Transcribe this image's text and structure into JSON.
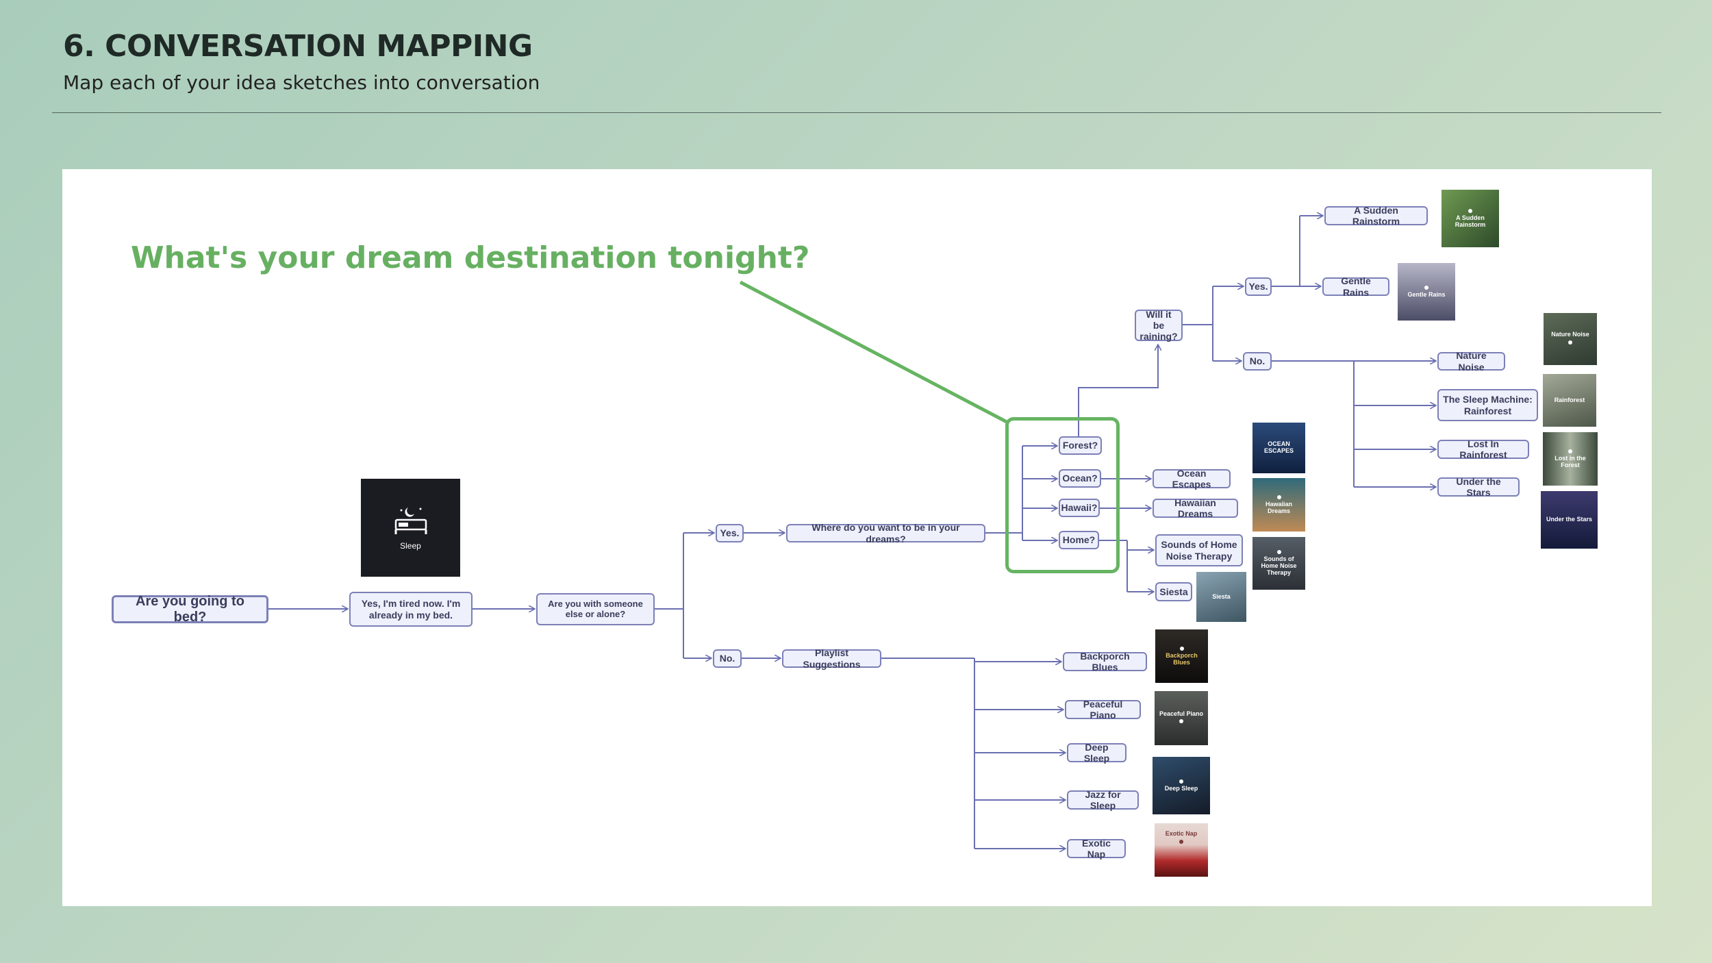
{
  "header": {
    "title": "6. CONVERSATION MAPPING",
    "subtitle": "Map each of your idea sketches into conversation"
  },
  "callout": {
    "text": "What's your dream destination tonight?",
    "color": "#67b062"
  },
  "colors": {
    "node_border": "#7c80b6",
    "node_fill": "#eef0fb",
    "edge": "#6a6fb0",
    "highlight": "#66b462"
  },
  "nodes": {
    "root": "Are you going to bed?",
    "tired": "Yes, I'm tired now. I'm already in my bed.",
    "alone": "Are you with someone else or alone?",
    "yes1": "Yes.",
    "no1": "No.",
    "where": "Where do you want to be in your dreams?",
    "playlist": "Playlist Suggestions",
    "forest": "Forest?",
    "ocean": "Ocean?",
    "hawaii": "Hawaii?",
    "home": "Home?",
    "raining": "Will it be raining?",
    "yes2": "Yes.",
    "no2": "No.",
    "sudden": "A Sudden Rainstorm",
    "gentle": "Gentle Rains",
    "nature": "Nature Noise",
    "sleepmachine": "The Sleep Machine: Rainforest",
    "lost": "Lost In Rainforest",
    "stars": "Under the Stars",
    "oceanesc": "Ocean Escapes",
    "hawaiian": "Hawaiian Dreams",
    "soundshome": "Sounds of Home Noise Therapy",
    "siesta": "Siesta",
    "backporch": "Backporch Blues",
    "piano": "Peaceful Piano",
    "deepsleep": "Deep Sleep",
    "jazz": "Jazz for Sleep",
    "exotic": "Exotic Nap"
  },
  "thumbs": {
    "sleep": {
      "label": "Sleep",
      "icon": "bed-moon-icon"
    },
    "sudden": "A Sudden Rainstorm",
    "gentle": "Gentle Rains",
    "nature": "Nature Noise",
    "rainforest": "Rainforest",
    "lost": "Lost in the Forest",
    "stars": "Under the Stars",
    "oceanesc": "OCEAN ESCAPES",
    "hawaiian": "Hawaiian Dreams",
    "soundshome": "Sounds of Home Noise Therapy",
    "siesta": "Siesta",
    "backporch": "Backporch Blues",
    "piano": "Peaceful Piano",
    "deepsleep": "Deep Sleep",
    "exotic": "Exotic Nap"
  }
}
